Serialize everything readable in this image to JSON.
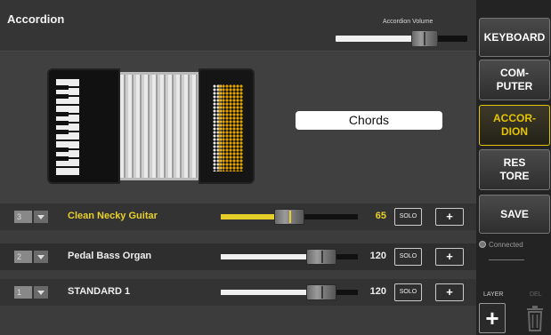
{
  "header": {
    "title": "Accordion",
    "volume_label": "Accordion Volume",
    "volume_level": 0.72
  },
  "chords_box": {
    "label": "Chords"
  },
  "tracks": [
    {
      "number": "3",
      "name": "Clean Necky Guitar",
      "value": "65",
      "level": 0.5,
      "active": true,
      "solo_label": "SOLO",
      "add_label": "+"
    },
    {
      "number": "2",
      "name": "Pedal Bass Organ",
      "value": "120",
      "level": 0.8,
      "active": false,
      "solo_label": "SOLO",
      "add_label": "+"
    },
    {
      "number": "1",
      "name": "STANDARD 1",
      "value": "120",
      "level": 0.8,
      "active": false,
      "solo_label": "SOLO",
      "add_label": "+"
    }
  ],
  "sidebar": {
    "buttons": [
      {
        "line1": "KEYBOARD",
        "line2": ""
      },
      {
        "line1": "COM-",
        "line2": "PUTER"
      },
      {
        "line1": "ACCOR-",
        "line2": "DION"
      },
      {
        "line1": "RES",
        "line2": "TORE"
      },
      {
        "line1": "SAVE",
        "line2": ""
      }
    ],
    "connected_label": "Connected",
    "layer_label": "LAYER",
    "del_label": "DEL",
    "add_icon": "+"
  },
  "colors": {
    "accent": "#e6c400",
    "active_text": "#e8d12a"
  }
}
